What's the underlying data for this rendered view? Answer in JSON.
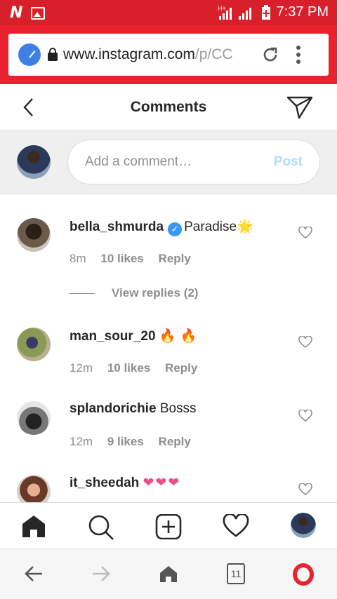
{
  "status": {
    "time": "7:37 PM",
    "network": "H+"
  },
  "browser": {
    "url_main": "www.instagram.com",
    "url_dim": "/p/CC",
    "bottom_tabs_count": "11"
  },
  "header": {
    "title": "Comments"
  },
  "composer": {
    "placeholder": "Add a comment…",
    "post_label": "Post"
  },
  "comments": [
    {
      "user": "bella_shmurda",
      "verified": true,
      "text": "Paradise",
      "emoji": "🌟",
      "age": "8m",
      "likes": "10 likes",
      "reply": "Reply",
      "view_replies": "View replies (2)"
    },
    {
      "user": "man_sour_20",
      "verified": false,
      "text": "",
      "emoji": "🔥 🔥",
      "age": "12m",
      "likes": "10 likes",
      "reply": "Reply"
    },
    {
      "user": "splandorichie",
      "verified": false,
      "text": "Bosss",
      "emoji": "",
      "age": "12m",
      "likes": "9 likes",
      "reply": "Reply"
    },
    {
      "user": "it_sheedah",
      "verified": false,
      "text": "",
      "emoji": "❤❤❤",
      "age": "",
      "likes": "",
      "reply": ""
    }
  ],
  "icons": {
    "tabbar": [
      "home-icon",
      "search-icon",
      "new-post-icon",
      "activity-heart-icon",
      "profile-avatar"
    ],
    "browserbar": [
      "back-arrow-icon",
      "forward-arrow-icon",
      "home-icon",
      "tabs-icon",
      "opera-icon"
    ]
  },
  "colors": {
    "statusbar": "#d8202a",
    "accent_blue": "#3897f0",
    "post_disabled": "#b3dbff"
  }
}
